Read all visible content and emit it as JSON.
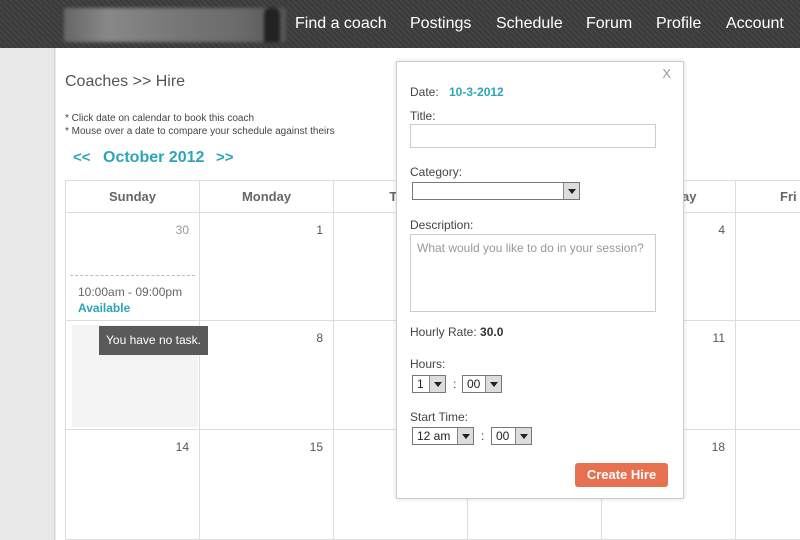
{
  "nav": {
    "items": [
      {
        "label": "Find a coach",
        "name": "nav-find-a-coach"
      },
      {
        "label": "Postings",
        "name": "nav-postings"
      },
      {
        "label": "Schedule",
        "name": "nav-schedule"
      },
      {
        "label": "Forum",
        "name": "nav-forum"
      },
      {
        "label": "Profile",
        "name": "nav-profile"
      },
      {
        "label": "Account",
        "name": "nav-account"
      }
    ]
  },
  "page": {
    "breadcrumb": "Coaches >> Hire",
    "notes": [
      "* Click date on calendar to book this coach",
      "* Mouse over a date to compare your schedule against theirs"
    ],
    "prev": "<<",
    "next": ">>",
    "month": "October 2012"
  },
  "calendar": {
    "headers": [
      "Sunday",
      "Monday",
      "Tue",
      "",
      "",
      "ay",
      "Fri"
    ],
    "week1": [
      "30",
      "1",
      "",
      "",
      "4",
      ""
    ],
    "week2": [
      "",
      "8",
      "",
      "",
      "11",
      ""
    ],
    "week3": [
      "14",
      "15",
      "",
      "",
      "18",
      ""
    ],
    "availability": {
      "time": "10:00am - 09:00pm",
      "status": "Available"
    },
    "tooltip": "You have no task."
  },
  "modal": {
    "close": "X",
    "date_label": "Date:",
    "date_value": "10-3-2012",
    "title_label": "Title:",
    "title_value": "",
    "category_label": "Category:",
    "category_value": "",
    "description_label": "Description:",
    "description_placeholder": "What would you like to do in your session?",
    "rate_label": "Hourly Rate:",
    "rate_value": "30.0",
    "hours_label": "Hours:",
    "hours_value": "1",
    "hours_minutes_value": "00",
    "start_label": "Start Time:",
    "start_hour_value": "12 am",
    "start_minutes_value": "00",
    "colon": ":",
    "create_button": "Create Hire"
  }
}
